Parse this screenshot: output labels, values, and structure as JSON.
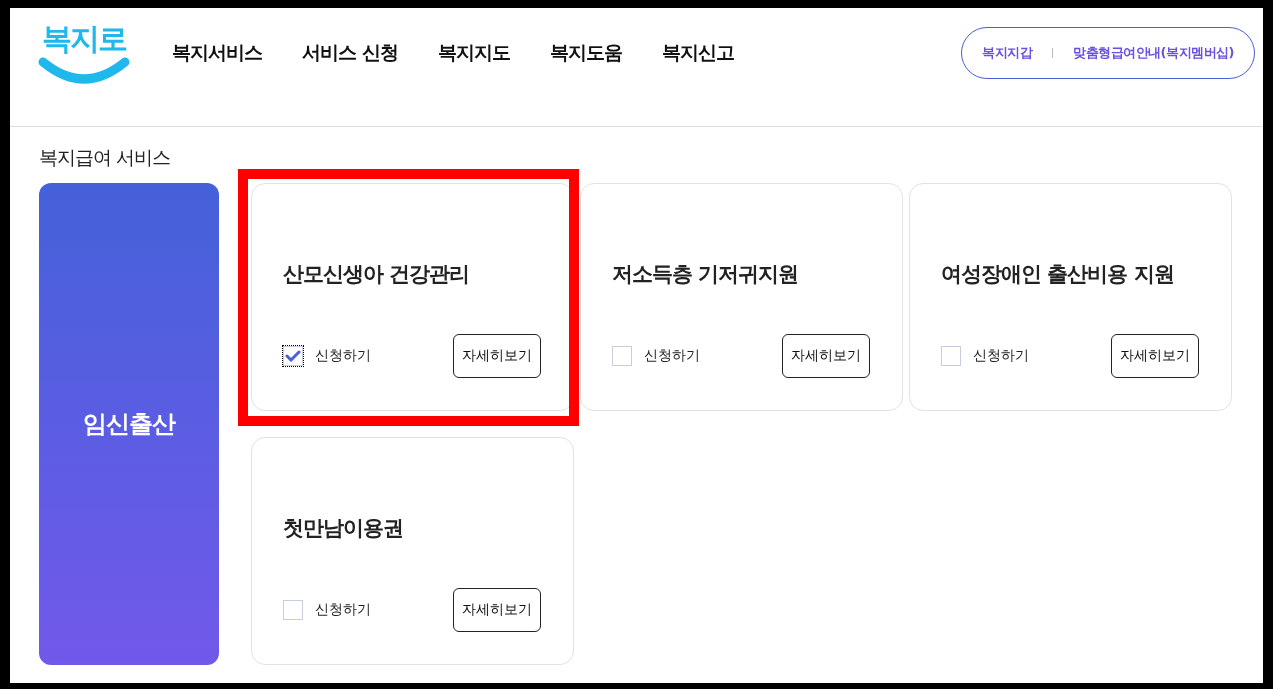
{
  "logo": {
    "text": "복지로"
  },
  "nav": [
    "복지서비스",
    "서비스 신청",
    "복지지도",
    "복지도움",
    "복지신고"
  ],
  "header_links": [
    "복지지갑",
    "맞춤형급여안내(복지멤버십)"
  ],
  "section_title": "복지급여 서비스",
  "category": "임신출산",
  "services": [
    {
      "title": "산모신생아 건강관리",
      "apply_label": "신청하기",
      "checked": true,
      "highlighted": true,
      "detail_button": "자세히보기"
    },
    {
      "title": "저소득층 기저귀지원",
      "apply_label": "신청하기",
      "checked": false,
      "highlighted": false,
      "detail_button": "자세히보기"
    },
    {
      "title": "여성장애인 출산비용 지원",
      "apply_label": "신청하기",
      "checked": false,
      "highlighted": false,
      "detail_button": "자세히보기"
    },
    {
      "title": "첫만남이용권",
      "apply_label": "신청하기",
      "checked": false,
      "highlighted": false,
      "detail_button": "자세히보기"
    }
  ]
}
